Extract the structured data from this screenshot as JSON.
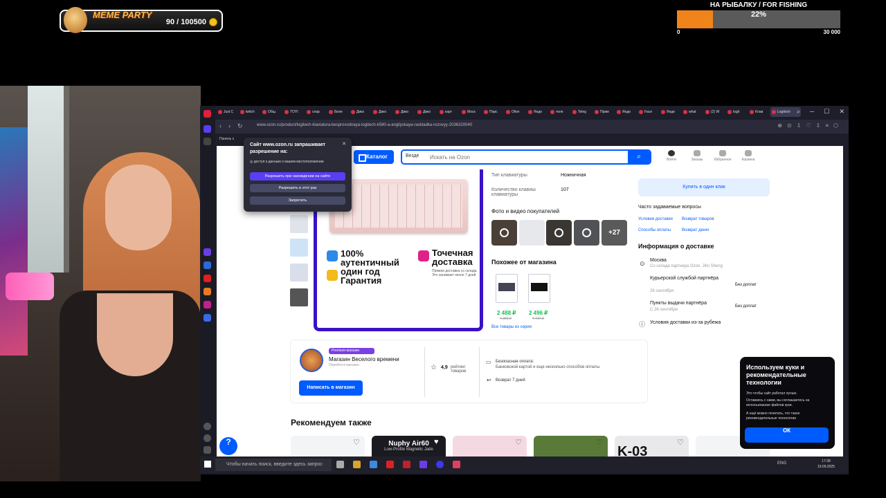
{
  "overlay": {
    "meme_title": "MEME PARTY",
    "meme_count": "90 / 100500",
    "goal_title": "НА РЫБАЛКУ / FOR FISHING",
    "goal_percent": "22%",
    "goal_progress": 0.22,
    "goal_min": "0",
    "goal_max": "30 000"
  },
  "browser": {
    "tabs": [
      "Just C",
      "twitch",
      "Общ",
      "TOYI",
      "спар",
      "Биле",
      "Дико",
      "Дико",
      "Дико",
      "Дико",
      "карт",
      "Моск",
      "Порс",
      "Olive",
      "Янде",
      "теле",
      "Teleg",
      "Прим",
      "Янде",
      "Face",
      "Янде",
      "what",
      "(2) W",
      "logit",
      "Клав",
      "Logitech"
    ],
    "url": "www.ozon.ru/product/logitech-klaviatura-besprovodnaya-logitech-k580-a-angliyskaya-raskladka-rozovyy-2036320040",
    "bookmark": "Панель s"
  },
  "ozon": {
    "catalog": "Каталог",
    "search_scope": "Везде",
    "search_placeholder": "Искать на Ozon",
    "header_icons": [
      "Войти",
      "Заказы",
      "Избранное",
      "Корзина"
    ],
    "product_badges": {
      "authentic": "100%\nаутентичный\nодин год\nГарантия",
      "delivery": "Точечная\nдоставка",
      "delivery_note": "Прямая доставка со склада Это занимает около 7 дней"
    },
    "specs": [
      {
        "label": "Тип клавиатуры",
        "value": "Ножничная"
      },
      {
        "label": "Количество клавиш клавиатуры",
        "value": "107"
      }
    ],
    "photos_title": "Фото и видео покупателей",
    "photos_more": "+27",
    "similar_title": "Похожее от магазина",
    "similar": [
      {
        "price": "2 488 ₽",
        "old": "4 256 ₽"
      },
      {
        "price": "2 496 ₽",
        "old": "4 737 ₽"
      }
    ],
    "similar_link": "Все товары из серии",
    "buy_one_click": "Купить в один клик",
    "faq_title": "Часто задаваемые вопросы",
    "faq_links": [
      "Условия доставки",
      "Возврат товаров",
      "Способы оплаты",
      "Возврат денег"
    ],
    "delivery_title": "Информация о доставке",
    "delivery_city": "Москва",
    "delivery_city_sub": "Со склада партнера Ozon, Jilin Sheng",
    "courier": "Курьерской службой партнёра",
    "courier_date": "26 сентября",
    "courier_price": "Без доплат",
    "pickup": "Пункты выдачи партнёра",
    "pickup_date": "С 26 сентября",
    "pickup_price": "Без доплат",
    "abroad": "Условия доставки из-за рубежа",
    "seller_badge": "Premium-магазин",
    "seller_name": "Магазин Веселого времени",
    "seller_sub": "Перейти в магазин",
    "write_store": "Написать в магазин",
    "rating": "4,9",
    "rating_label": "рейтинг товаров",
    "pay_title": "Безопасная оплата:",
    "pay_desc": "Банковской картой и еще несколько способов оплаты",
    "return": "Возврат 7 дней",
    "recommend_title": "Рекомендуем также",
    "rec_banner_title": "Nuphy Air60",
    "rec_banner_sub": "Low-Profile Magnetic Jade",
    "rec_banner2": "K-03"
  },
  "permission": {
    "title": "Сайт www.ozon.ru запрашивает разрешение на:",
    "request": "доступ к данным о вашем местоположении",
    "allow_site": "Разрешить при нахождении на сайте",
    "allow_once": "Разрешить в этот раз",
    "deny": "Запретить"
  },
  "cookie": {
    "title": "Используем куки и рекомендательные технологии",
    "text1": "Это чтобы сайт работал лучше.",
    "text2": "Оставаясь с нами, вы соглашаетесь на использование файлов куки.",
    "text3": "А ещё можно почитать, что такое рекомендательные технологии",
    "ok": "ОК"
  },
  "taskbar": {
    "search_placeholder": "Чтобы начать поиск, введите здесь запрос",
    "lang": "ENG",
    "time": "17:38",
    "date": "19.09.2025"
  },
  "colors": {
    "ozon_blue": "#005bff",
    "premium": "#7b3fe4",
    "goal_fill": "#f0841a"
  }
}
